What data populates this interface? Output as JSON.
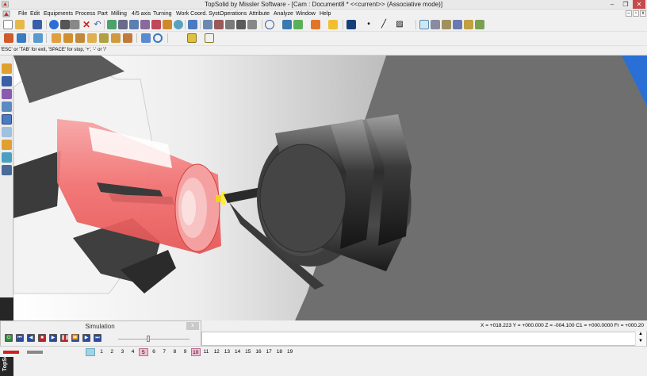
{
  "window": {
    "title": "TopSolid by Missler Software - [Cam : Document8 *  <<current>> (Associative mode)]",
    "min_glyph": "–",
    "max_glyph": "❐",
    "close_glyph": "✕"
  },
  "menu": {
    "items": [
      "File",
      "Edit",
      "Equipments",
      "Process",
      "Part",
      "Milling",
      "4/5 axis",
      "Turning",
      "Work Coord. Syst.",
      "Operations",
      "Attribute",
      "Analyze",
      "Window",
      "Help"
    ],
    "mdi_min": "–",
    "mdi_restore": "▫",
    "mdi_close": "x"
  },
  "status_hint": "'ESC' or 'TAB' for exit, 'SPACE' for stop, '+', '-' or '/'",
  "side_brand": "TopSolid'Cam",
  "simulation": {
    "title": "Simulation",
    "close_glyph": "x",
    "controls": [
      {
        "name": "sim-power-button",
        "color": "#2e8b3c",
        "glyph": "⏻"
      },
      {
        "name": "sim-first-button",
        "color": "#2c4c9c",
        "glyph": "⏮"
      },
      {
        "name": "sim-step-back-button",
        "color": "#2c4c9c",
        "glyph": "◀"
      },
      {
        "name": "sim-stop-button",
        "color": "#b02828",
        "glyph": "■"
      },
      {
        "name": "sim-play-button",
        "color": "#2c4c9c",
        "glyph": "▶"
      },
      {
        "name": "sim-pause-button",
        "color": "#b02828",
        "glyph": "❚❚"
      },
      {
        "name": "sim-fast-forward-button",
        "color": "#2c4c9c",
        "glyph": "⏩"
      },
      {
        "name": "sim-step-forward-button",
        "color": "#2c4c9c",
        "glyph": "▶"
      },
      {
        "name": "sim-last-button",
        "color": "#2c4c9c",
        "glyph": "⏭"
      }
    ]
  },
  "coordinates": "X = +018.223  Y = +000.000  Z = -004.100  C1 = +000.0000  Fr = +000.20",
  "layers": [
    "1",
    "2",
    "3",
    "4",
    "5",
    "6",
    "7",
    "8",
    "9",
    "10",
    "11",
    "12",
    "13",
    "14",
    "15",
    "16",
    "17",
    "18",
    "19"
  ],
  "current_layer": "10",
  "highlighted_layer": "5",
  "colors": {
    "part_highlight": "#f06b6b",
    "tool_holder": "#3a3a3a",
    "lathe_chuck": "#e8e8e8",
    "background_dark": "#6f6f6f",
    "accent_blue": "#2a6fd6"
  }
}
